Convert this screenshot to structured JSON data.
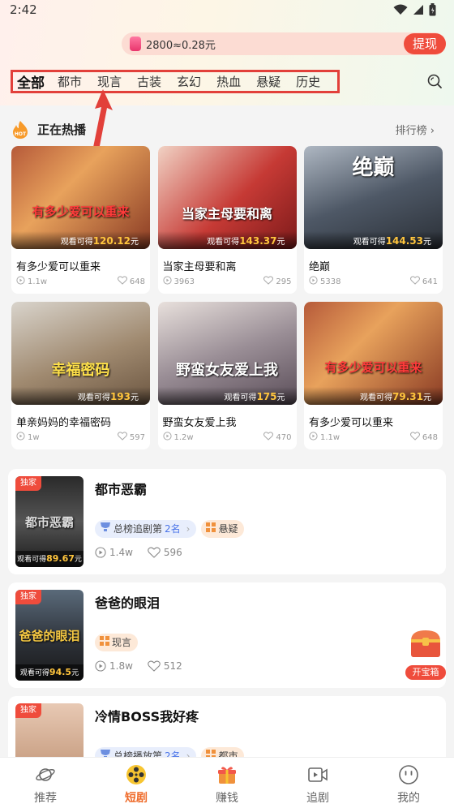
{
  "status": {
    "time": "2:42"
  },
  "coins": {
    "text": "2800≈0.28元",
    "withdraw_label": "提现"
  },
  "categories": [
    "全部",
    "都市",
    "现言",
    "古装",
    "玄幻",
    "热血",
    "悬疑",
    "历史"
  ],
  "hot": {
    "title": "正在热播",
    "rank_label": "排行榜",
    "hot_badge": "HOT"
  },
  "earn_prefix": "观看可得",
  "earn_suffix": "元",
  "grid": [
    {
      "title": "有多少爱可以重来",
      "earn": "120.12",
      "views": "1.1w",
      "likes": "648",
      "poster_text": "有多少爱可以重来"
    },
    {
      "title": "当家主母要和离",
      "earn": "143.37",
      "views": "3963",
      "likes": "295",
      "poster_text": "当家主母要和离"
    },
    {
      "title": "绝巅",
      "earn": "144.53",
      "views": "5338",
      "likes": "641",
      "poster_text": "绝巅"
    },
    {
      "title": "单亲妈妈的幸福密码",
      "earn": "193",
      "views": "1w",
      "likes": "597",
      "poster_text": "幸福密码"
    },
    {
      "title": "野蛮女友爱上我",
      "earn": "175",
      "views": "1.2w",
      "likes": "470",
      "poster_text": "野蛮女友爱上我"
    },
    {
      "title": "有多少爱可以重来",
      "earn": "79.31",
      "views": "1.1w",
      "likes": "648",
      "poster_text": "有多少爱可以重来"
    }
  ],
  "list": [
    {
      "name": "都市恶霸",
      "exclusive": "独家",
      "earn": "89.67",
      "rank_prefix": "总榜追剧第",
      "rank_num": "2名",
      "genre": "悬疑",
      "views": "1.4w",
      "likes": "596",
      "cover_text": "都市恶霸"
    },
    {
      "name": "爸爸的眼泪",
      "exclusive": "独家",
      "earn": "94.5",
      "genre": "现言",
      "views": "1.8w",
      "likes": "512",
      "cover_text": "爸爸的眼泪"
    },
    {
      "name": "冷情BOSS我好疼",
      "exclusive": "独家",
      "rank_prefix": "总榜播放第",
      "rank_num": "2名",
      "genre": "都市"
    }
  ],
  "treasure": {
    "label": "开宝箱"
  },
  "tabs": [
    {
      "label": "推荐",
      "icon": "planet-icon"
    },
    {
      "label": "短剧",
      "icon": "film-reel-icon"
    },
    {
      "label": "赚钱",
      "icon": "gift-icon"
    },
    {
      "label": "追剧",
      "icon": "video-camera-icon"
    },
    {
      "label": "我的",
      "icon": "smiley-icon"
    }
  ],
  "colors": {
    "accent": "#ef4c3c",
    "active_tab": "#ef6b2a",
    "earn": "#ffc53d"
  }
}
